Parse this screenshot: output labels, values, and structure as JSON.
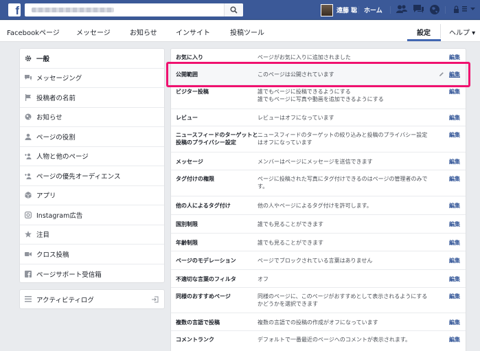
{
  "topbar": {
    "logo": "f",
    "user_name": "遠藤 聡",
    "home": "ホーム"
  },
  "pagenav": {
    "items": [
      "Facebookページ",
      "メッセージ",
      "お知らせ",
      "インサイト",
      "投稿ツール"
    ],
    "settings": "設定",
    "help": "ヘルプ ▾"
  },
  "leftmenu": {
    "items": [
      {
        "label": "一般",
        "icon": "gear-icon"
      },
      {
        "label": "メッセージング",
        "icon": "chat-icon"
      },
      {
        "label": "投稿者の名前",
        "icon": "flag-icon"
      },
      {
        "label": "お知らせ",
        "icon": "globe-icon"
      },
      {
        "label": "ページの役割",
        "icon": "person-icon"
      },
      {
        "label": "人物と他のページ",
        "icon": "person-plus-icon"
      },
      {
        "label": "ページの優先オーディエンス",
        "icon": "person-plus-icon"
      },
      {
        "label": "アプリ",
        "icon": "cube-icon"
      },
      {
        "label": "Instagram広告",
        "icon": "instagram-icon"
      },
      {
        "label": "注目",
        "icon": "star-icon"
      },
      {
        "label": "クロス投稿",
        "icon": "video-icon"
      },
      {
        "label": "ページサポート受信箱",
        "icon": "facebook-icon"
      }
    ],
    "activity": "アクティビティログ"
  },
  "settings": {
    "edit_label": "編集",
    "rows": [
      {
        "label": "お気に入り",
        "value": "ページがお気に入りに追加されました"
      },
      {
        "label": "公開範囲",
        "value": "このページは公開されています"
      },
      {
        "label": "ビジター投稿",
        "value": "誰でもページに投稿できるようにする\n誰でもページに写真や動画を追加できるようにする"
      },
      {
        "label": "レビュー",
        "value": "レビューはオフになっています"
      },
      {
        "label": "ニュースフィードのターゲットと\n投稿のプライバシー設定",
        "value": "ニュースフィードのターゲットの絞り込みと投稿のプライバシー設定\nはオフになっています"
      },
      {
        "label": "メッセージ",
        "value": "メンバーはページにメッセージを送信できます"
      },
      {
        "label": "タグ付けの権限",
        "value": "ページに投稿された写真にタグ付けできるのはページの管理者のみで\nす。"
      },
      {
        "label": "他の人によるタグ付け",
        "value": "他の人やページによるタグ付けを許可します。"
      },
      {
        "label": "国別制限",
        "value": "誰でも見ることができます"
      },
      {
        "label": "年齢制限",
        "value": "誰でも見ることができます"
      },
      {
        "label": "ページのモデレーション",
        "value": "ページでブロックされている言葉はありません"
      },
      {
        "label": "不適切な言葉のフィルタ",
        "value": "オフ"
      },
      {
        "label": "同様のおすすめページ",
        "value": "同様のページに、このページがおすすめとして表示されるようにする\nかどうかを選択できます"
      },
      {
        "label": "複数の言語で投稿",
        "value": "複数の言語での投稿の作成がオフになっています"
      },
      {
        "label": "コメントランク",
        "value": "デフォルトで一番最近のページへのコメントが表示されます。"
      }
    ]
  },
  "colors": {
    "brand": "#3b5998",
    "link": "#365899",
    "highlight": "#f0116f"
  }
}
